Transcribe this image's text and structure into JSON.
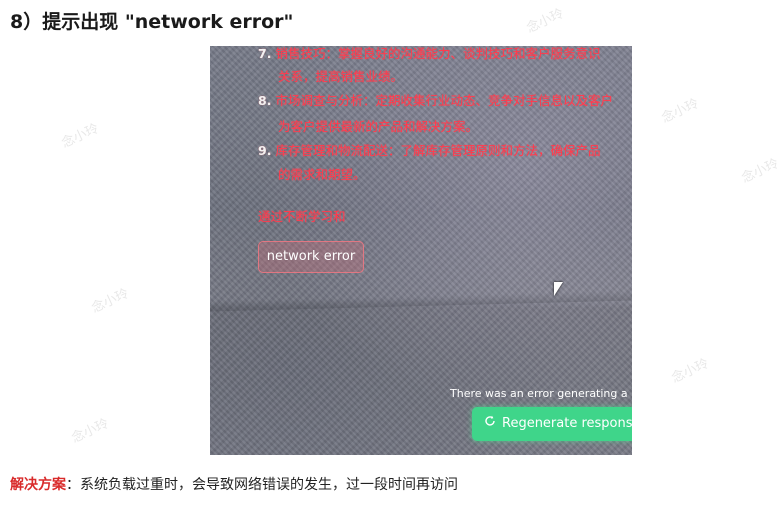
{
  "heading": "8）提示出现 \"network error\"",
  "screenshot": {
    "list": [
      {
        "num": "7.",
        "line1": "销售技巧：掌握良好的沟通能力、谈判技巧和客户服务意识",
        "line2": "关系，提高销售业绩。"
      },
      {
        "num": "8.",
        "line1": "市场调查与分析：定期收集行业动态、竞争对手信息以及客户",
        "line2": "为客户提供最新的产品和解决方案。"
      },
      {
        "num": "9.",
        "line1": "库存管理和物流配送：了解库存管理原则和方法，确保产品",
        "line2": "的需求和期望。"
      }
    ],
    "partial_line": "通过不断学习和",
    "error_chip": "network error",
    "generating_error": "There was an error generating a respo",
    "regenerate_label": "Regenerate response",
    "regenerate_icon": "refresh-icon"
  },
  "solution": {
    "label": "解决方案",
    "text": "：系统负载过重时，会导致网络错误的发生，过一段时间再访问"
  },
  "watermark_text": "念小玲"
}
